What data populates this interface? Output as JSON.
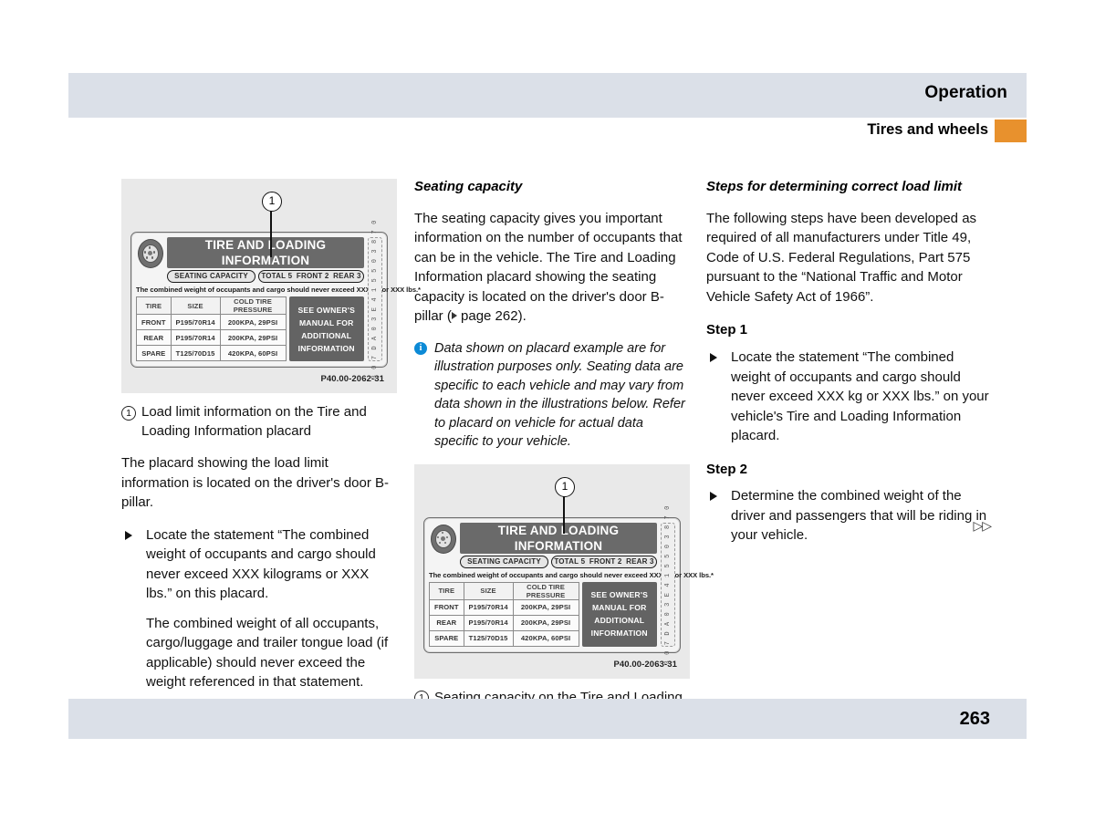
{
  "header": {
    "title": "Operation",
    "subtitle": "Tires and wheels",
    "tab_color": "#e8912d",
    "band_color": "#dbe0e8"
  },
  "footer": {
    "page_number": "263"
  },
  "figure_left": {
    "callout_number": "1",
    "code": "P40.00-2062-31",
    "caption_number": "1",
    "caption_text": "Load limit information on the Tire and Loading Information placard",
    "placard": {
      "title": "TIRE AND LOADING INFORMATION",
      "seating_capacity_label": "SEATING CAPACITY",
      "seating_total_label": "TOTAL",
      "seating_total_value": "5",
      "seating_front_label": "FRONT",
      "seating_front_value": "2",
      "seating_rear_label": "REAR",
      "seating_rear_value": "3",
      "warning": "The combined weight of occupants and cargo should never exceed XXX kg or XXX lbs.*",
      "table_headers": [
        "TIRE",
        "SIZE",
        "COLD TIRE PRESSURE"
      ],
      "table_rows": [
        [
          "FRONT",
          "P195/70R14",
          "200KPA, 29PSI"
        ],
        [
          "REAR",
          "P195/70R14",
          "200KPA, 29PSI"
        ],
        [
          "SPARE",
          "T125/70D15",
          "420KPA, 60PSI"
        ]
      ],
      "owner_note_lines": [
        "SEE OWNER'S",
        "MANUAL FOR",
        "ADDITIONAL",
        "INFORMATION"
      ],
      "side_code": "3 0 7 D A 0 3 E 4 1 5 5 0 3 8 7 0"
    }
  },
  "figure_mid": {
    "callout_number": "1",
    "code": "P40.00-2063-31",
    "caption_number": "1",
    "caption_text": "Seating capacity on the Tire and Loading Information placard",
    "placard": {
      "title": "TIRE AND LOADING INFORMATION",
      "seating_capacity_label": "SEATING CAPACITY",
      "seating_total_label": "TOTAL",
      "seating_total_value": "5",
      "seating_front_label": "FRONT",
      "seating_front_value": "2",
      "seating_rear_label": "REAR",
      "seating_rear_value": "3",
      "warning": "The combined weight of occupants and cargo should never exceed XXX kg or XXX lbs.*",
      "table_headers": [
        "TIRE",
        "SIZE",
        "COLD TIRE PRESSURE"
      ],
      "table_rows": [
        [
          "FRONT",
          "P195/70R14",
          "200KPA, 29PSI"
        ],
        [
          "REAR",
          "P195/70R14",
          "200KPA, 29PSI"
        ],
        [
          "SPARE",
          "T125/70D15",
          "420KPA, 60PSI"
        ]
      ],
      "owner_note_lines": [
        "SEE OWNER'S",
        "MANUAL FOR",
        "ADDITIONAL",
        "INFORMATION"
      ],
      "side_code": "3 0 7 D A 0 3 E 4 1 5 5 0 3 8 7 0"
    }
  },
  "column_left": {
    "paragraph_1": "The placard showing the load limit information is located on the driver's door B-pillar.",
    "bullet_1": "Locate the statement “The combined weight of occupants and cargo should never exceed XXX kilograms or XXX lbs.” on this placard.",
    "sub_paragraph_1": "The combined weight of all occupants, cargo/luggage and trailer tongue load (if applicable) should never exceed the weight referenced in that statement."
  },
  "column_mid": {
    "section_title": "Seating capacity",
    "paragraph_1_part_a": "The seating capacity gives you important information on the number of occupants that can be in the vehicle. The Tire and Loading Information placard showing the seating capacity is located on the driver's door B-pillar (",
    "paragraph_1_pageref": "page 262",
    "paragraph_1_part_b": ").",
    "note": "Data shown on placard example are for illustration purposes only. Seating data are specific to each vehicle and may vary from data shown in the illustrations below. Refer to placard on vehicle for actual data specific to your vehicle."
  },
  "column_right": {
    "section_title": "Steps for determining correct load limit",
    "paragraph_1": "The following steps have been developed as required of all manufacturers under Title 49, Code of U.S. Federal Regulations, Part 575 pursuant to the “National Traffic and Motor Vehicle Safety Act of 1966”.",
    "step_1_title": "Step 1",
    "step_1_bullet": "Locate the statement “The combined weight of occupants and cargo should never exceed XXX kg or XXX lbs.” on your vehicle's Tire and Loading Information placard.",
    "step_2_title": "Step 2",
    "step_2_bullet": "Determine the combined weight of the driver and passengers that will be riding in your vehicle.",
    "continuation_marker": "▷▷"
  }
}
